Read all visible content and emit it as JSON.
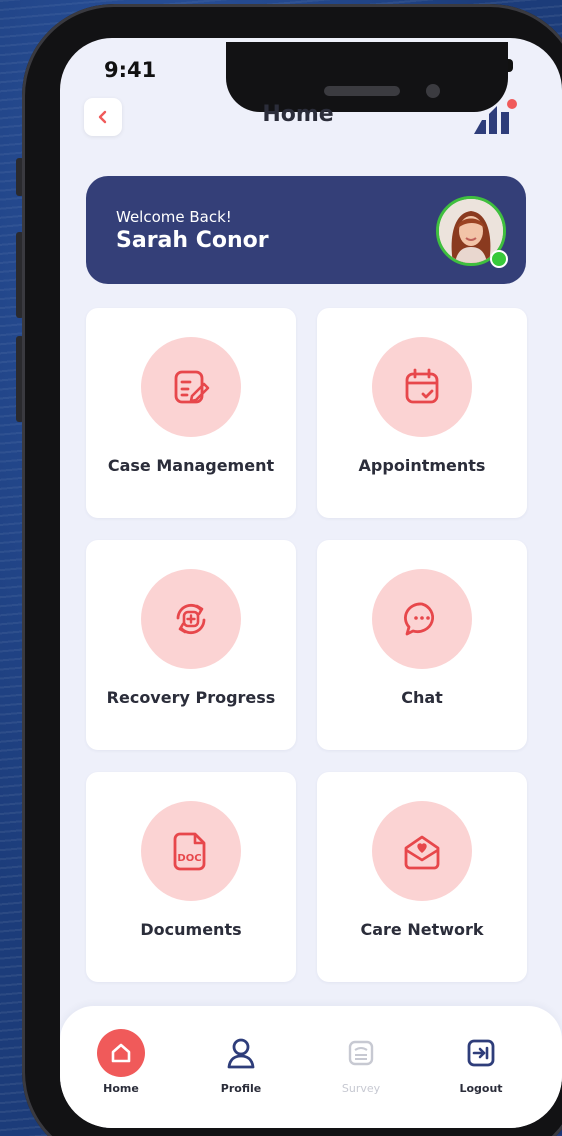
{
  "status_bar": {
    "time": "9:41"
  },
  "header": {
    "title": "Home"
  },
  "welcome": {
    "greeting": "Welcome Back!",
    "user_name": "Sarah Conor"
  },
  "menu": [
    {
      "label": "Case Management",
      "icon": "edit-note-icon"
    },
    {
      "label": "Appointments",
      "icon": "calendar-check-icon"
    },
    {
      "label": "Recovery Progress",
      "icon": "recovery-cycle-icon"
    },
    {
      "label": "Chat",
      "icon": "chat-bubble-icon"
    },
    {
      "label": "Documents",
      "icon": "doc-file-icon"
    },
    {
      "label": "Care Network",
      "icon": "heart-mail-icon"
    }
  ],
  "bottom_nav": [
    {
      "label": "Home",
      "icon": "home-icon",
      "active": true
    },
    {
      "label": "Profile",
      "icon": "user-icon"
    },
    {
      "label": "Survey",
      "icon": "survey-icon",
      "disabled": true
    },
    {
      "label": "Logout",
      "icon": "logout-icon"
    }
  ],
  "colors": {
    "accent": "#f05a5a",
    "icon_bg": "#fbd3d3",
    "banner": "#343f78",
    "screen_bg": "#eef0fa",
    "online": "#38c93a"
  }
}
